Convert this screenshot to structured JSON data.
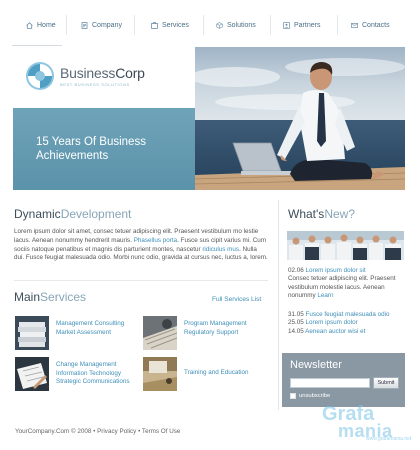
{
  "nav": {
    "items": [
      {
        "label": "Home",
        "icon": "house-icon"
      },
      {
        "label": "Company",
        "icon": "document-icon"
      },
      {
        "label": "Services",
        "icon": "building-icon"
      },
      {
        "label": "Solutions",
        "icon": "cube-icon"
      },
      {
        "label": "Partners",
        "icon": "user-card-icon"
      },
      {
        "label": "Contacts",
        "icon": "envelope-icon"
      }
    ]
  },
  "hero": {
    "logo_name_a": "Business",
    "logo_name_b": "Corp",
    "logo_tagline": "BEST BUSINESS SOLUTIONS",
    "title_line1": "15 Years Of Business",
    "title_line2": "Achievements"
  },
  "dynamic": {
    "title_a": "Dynamic",
    "title_b": "Development",
    "text_1": "Lorem ipsum dolor sit amet, consec tetuer adipiscing elit. Praesent vestibulum mo lestie lacus. Aenean nonummy hendrerit mauris. ",
    "link_1": "Phasellus porta",
    "text_2": ". Fusce sus cipit varius mi. Cum sociis natoque penatibus et magnis dis parturient montes, nascetur ",
    "link_2": "ridiculus mus",
    "text_3": ". Nulla dui. Fusce feugiat malesuada odio. Morbi nunc odio, gravida at cursus nec, luctus a, lorem."
  },
  "services": {
    "title_a": "Main",
    "title_b": "Services",
    "full_link": "Full Services List",
    "items": [
      {
        "line1": "Management Consulting",
        "line2": "Market Assessment",
        "line3": ""
      },
      {
        "line1": "Program Management",
        "line2": "Regulatory Support",
        "line3": ""
      },
      {
        "line1": "Change Management",
        "line2": "Information Technology",
        "line3": "Strategic Communications"
      },
      {
        "line1": "Training and Education",
        "line2": "",
        "line3": ""
      }
    ]
  },
  "whats_new": {
    "title_a": "What's",
    "title_b": "New?",
    "entries": [
      {
        "date": "02.06",
        "link": "Lorem ipsum dolor sit",
        "body": "Consec tetuer adipiscing elit. Praesent vestibulum molestie lacus. Aenean nonummy ",
        "more": "Learn"
      },
      {
        "date": "31.05",
        "link": "Fusce feugiat malesuada odio"
      },
      {
        "date": "25.05",
        "link": "Lorem ipsum dolor"
      },
      {
        "date": "14.05",
        "link": "Aenean auctor wisi et"
      }
    ]
  },
  "newsletter": {
    "title": "Newsletter",
    "input_value": "",
    "submit_label": "Submit",
    "unsubscribe_label": "unsubscribe"
  },
  "footer": {
    "copyright": "YourCompany.Com © 2008 •",
    "privacy": "Privacy Policy",
    "sep": "•",
    "terms": "Terms Of Use"
  },
  "watermark": {
    "line1": "Grafa",
    "line2": "mania",
    "line3": "www.grafamania.net"
  },
  "colors": {
    "accent_teal": "#6fa3b9",
    "link_blue": "#3e8fb8",
    "heading_dark": "#3d4e5b",
    "newsletter_gray": "#8a98a4"
  }
}
